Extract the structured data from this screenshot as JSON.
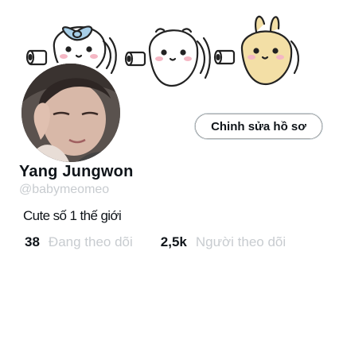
{
  "profile": {
    "display_name": "Yang Jungwon",
    "handle": "@babymeomeo",
    "bio": "Cute số 1 thế giới"
  },
  "actions": {
    "edit_profile_label": "Chinh sửa hồ sơ"
  },
  "stats": {
    "following_count": "38",
    "following_label": "Đang theo dõi",
    "followers_count": "2,5k",
    "followers_label": "Người theo dõi"
  },
  "colors": {
    "text_primary": "#0f1419",
    "text_secondary": "#c8ccd0",
    "button_border": "#cfd9de",
    "banner_bow": "#a8cfe8",
    "banner_bunny": "#f3dfa6"
  },
  "icons": {
    "banner": "chiikawa-characters-toilet-paper-illustration",
    "avatar": "profile-photo"
  }
}
